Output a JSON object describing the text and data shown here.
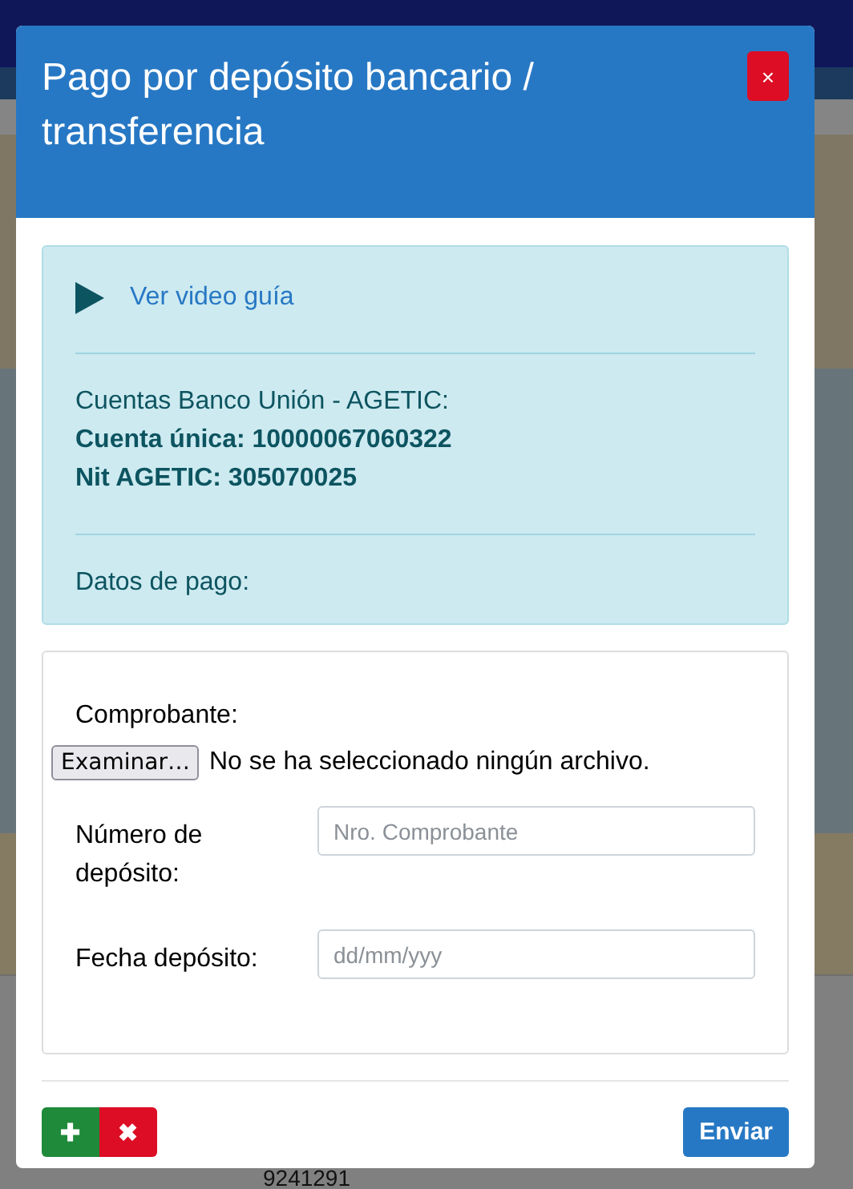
{
  "background": {
    "phone_number": "9241291"
  },
  "modal": {
    "title": "Pago por depósito bancario / transferencia",
    "close": "×",
    "info": {
      "video_link": "Ver video guía",
      "accounts_title": "Cuentas Banco Unión - AGETIC:",
      "account": "Cuenta única: 10000067060322",
      "nit": "Nit AGETIC: 305070025",
      "payment_data": "Datos de pago:"
    },
    "form": {
      "file_label": "Comprobante:",
      "file_button": "Examinar…",
      "file_status": "No se ha seleccionado ningún archivo.",
      "fields": [
        {
          "label": "Número de depósito:",
          "placeholder": "Nro. Comprobante"
        },
        {
          "label": "Fecha depósito:",
          "placeholder": "dd/mm/yyy"
        }
      ]
    },
    "footer": {
      "add": "✚",
      "remove": "✖",
      "submit": "Enviar"
    }
  }
}
